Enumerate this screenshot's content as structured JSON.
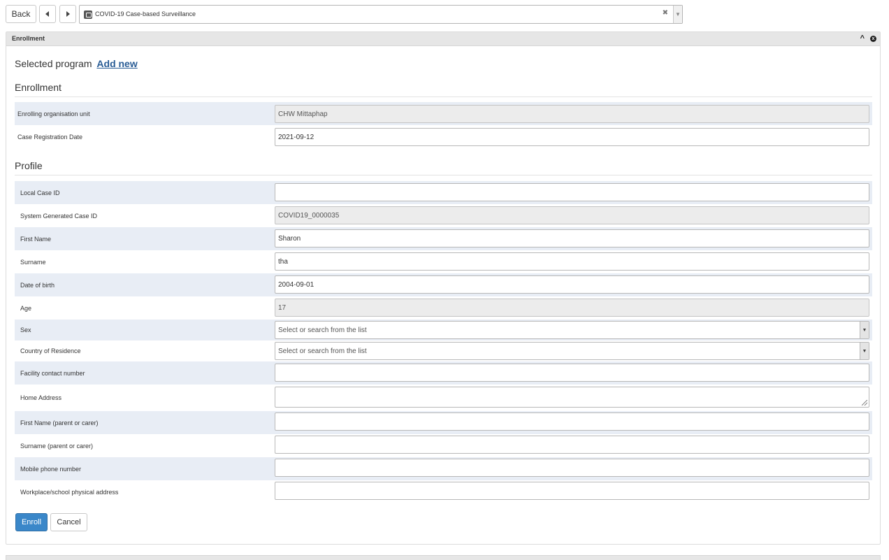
{
  "toolbar": {
    "back_label": "Back",
    "prev_icon": "triangle-left-icon",
    "next_icon": "triangle-right-icon",
    "program": "COVID-19 Case-based Surveillance",
    "program_icon": "program-icon",
    "clear_symbol": "✖",
    "caret_symbol": "▼"
  },
  "panel": {
    "title": "Enrollment",
    "collapse_symbol": "^",
    "close_symbol": "x"
  },
  "selected_program": {
    "label": "Selected program",
    "add_new": "Add new"
  },
  "sections": {
    "enrollment": "Enrollment",
    "profile": "Profile"
  },
  "enrollment_fields": [
    {
      "label": "Enrolling organisation unit",
      "value": "CHW Mittaphap",
      "readonly": true
    },
    {
      "label": "Case Registration Date",
      "value": "2021-09-12",
      "readonly": false
    }
  ],
  "profile_fields": [
    {
      "label": "Local Case ID",
      "value": ""
    },
    {
      "label": "System Generated Case ID",
      "value": "COVID19_0000035"
    },
    {
      "label": "First Name",
      "value": "Sharon"
    },
    {
      "label": "Surname",
      "value": "tha"
    },
    {
      "label": "Date of birth",
      "value": "2004-09-01"
    },
    {
      "label": "Age",
      "value": "17"
    },
    {
      "label": "Sex",
      "value": "Select or search from the list"
    },
    {
      "label": "Country of Residence",
      "value": "Select or search from the list"
    },
    {
      "label": "Facility contact number",
      "value": ""
    },
    {
      "label": "Home Address",
      "value": ""
    },
    {
      "label": "First Name (parent or carer)",
      "value": ""
    },
    {
      "label": "Surname (parent or carer)",
      "value": ""
    },
    {
      "label": "Mobile phone number",
      "value": ""
    },
    {
      "label": "Workplace/school physical address",
      "value": ""
    }
  ],
  "actions": {
    "enroll": "Enroll",
    "cancel": "Cancel"
  },
  "colors": {
    "primary_button": "#3a87c9",
    "link": "#2a5d96",
    "stripe": "#e8edf5",
    "header": "#e6e6e6"
  }
}
